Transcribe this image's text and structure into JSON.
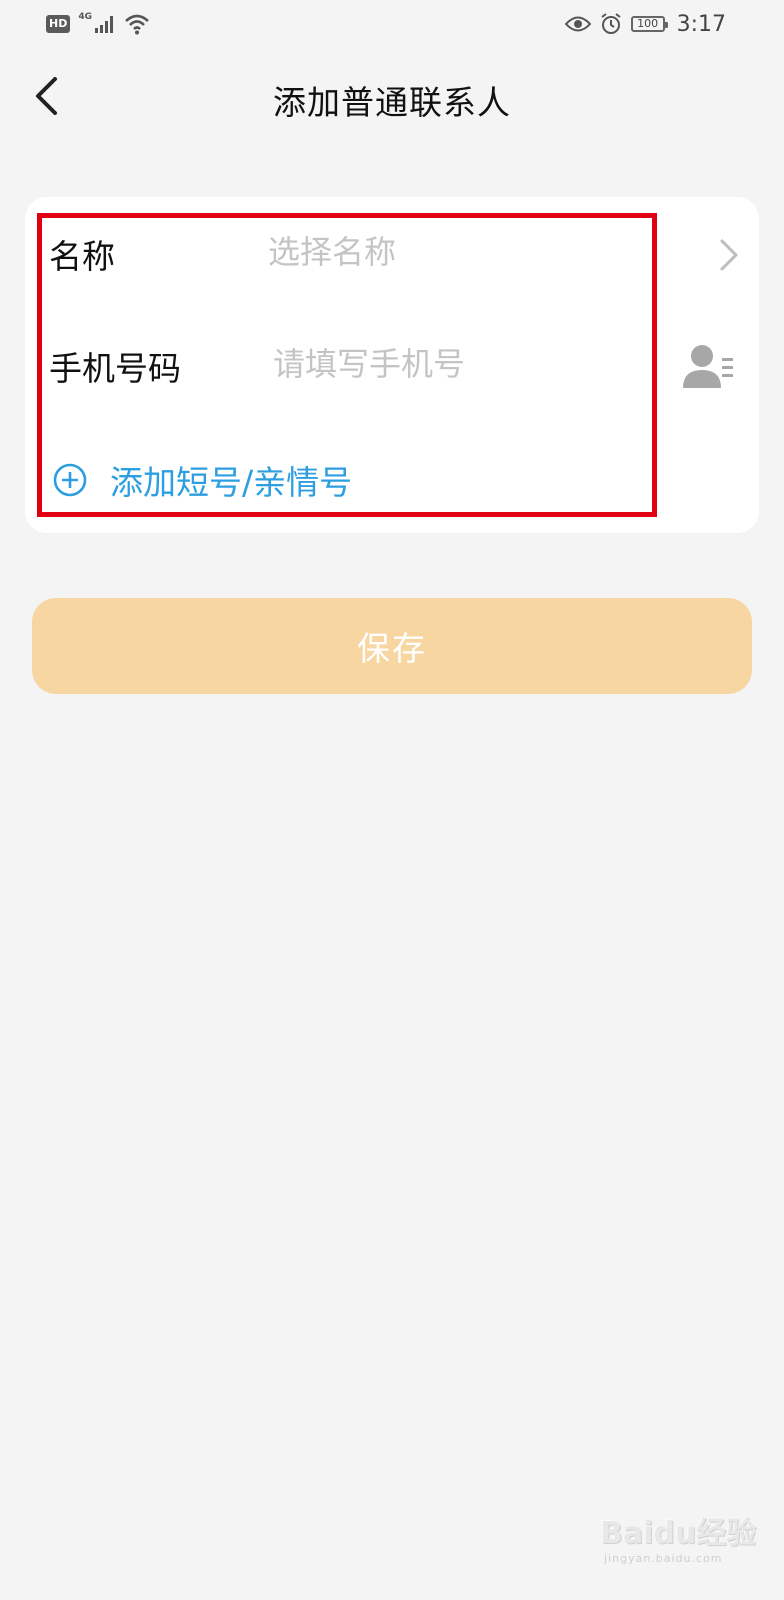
{
  "status_bar": {
    "hd_badge": "HD",
    "network": "4G",
    "battery_level": "100",
    "time": "3:17",
    "icons": [
      "signal-icon",
      "wifi-icon",
      "eye-icon",
      "alarm-icon",
      "battery-icon"
    ]
  },
  "header": {
    "title": "添加普通联系人",
    "back_icon": "chevron-left-icon"
  },
  "form": {
    "name": {
      "label": "名称",
      "placeholder": "选择名称",
      "icon": "chevron-right-icon"
    },
    "phone": {
      "label": "手机号码",
      "placeholder": "请填写手机号",
      "icon": "contact-picker-icon"
    },
    "add_short": {
      "label": "添加短号/亲情号",
      "icon": "plus-circle-icon"
    }
  },
  "save_button": {
    "label": "保存"
  },
  "watermark": {
    "brand": "Baidu经验",
    "url": "jingyan.baidu.com"
  },
  "colors": {
    "background": "#f4f4f4",
    "card": "#ffffff",
    "highlight_border": "#e00012",
    "link_blue": "#2d9fe0",
    "save_button_bg": "#f7d6a1",
    "placeholder": "#c4c4c4"
  }
}
